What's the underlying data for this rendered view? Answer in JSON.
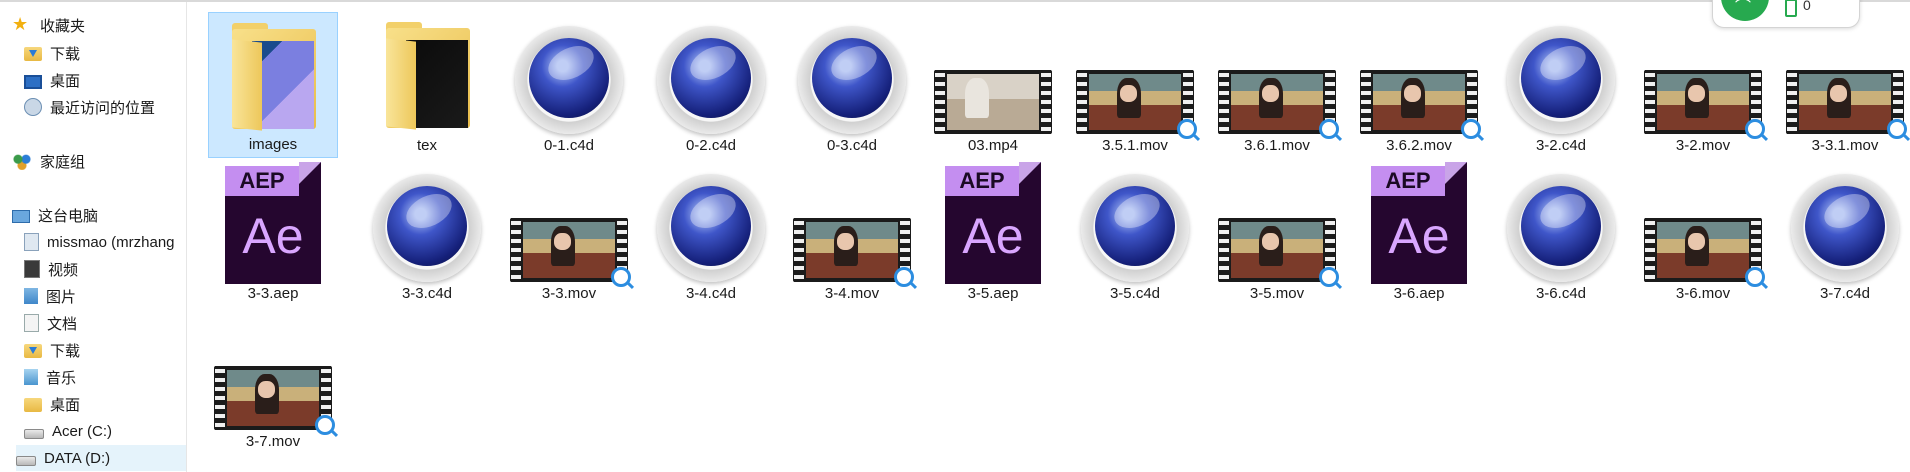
{
  "sidebar": {
    "items": [
      {
        "label": "收藏夹",
        "icon": "star-icon"
      },
      {
        "label": "下载",
        "icon": "downloads-folder-icon"
      },
      {
        "label": "桌面",
        "icon": "desktop-icon"
      },
      {
        "label": "最近访问的位置",
        "icon": "recent-places-icon"
      },
      {
        "label": "家庭组",
        "icon": "homegroup-icon"
      },
      {
        "label": "这台电脑",
        "icon": "this-pc-icon"
      },
      {
        "label": "missmao (mrzhang",
        "icon": "user-icon"
      },
      {
        "label": "视频",
        "icon": "videos-icon"
      },
      {
        "label": "图片",
        "icon": "pictures-icon"
      },
      {
        "label": "文档",
        "icon": "documents-icon"
      },
      {
        "label": "下载",
        "icon": "downloads-folder-icon"
      },
      {
        "label": "音乐",
        "icon": "music-icon"
      },
      {
        "label": "桌面",
        "icon": "desktop-folder-icon"
      },
      {
        "label": "Acer (C:)",
        "icon": "drive-icon"
      },
      {
        "label": "DATA (D:)",
        "icon": "drive-icon"
      }
    ]
  },
  "files": [
    {
      "name": "images",
      "type": "folder",
      "selected": true
    },
    {
      "name": "tex",
      "type": "folder"
    },
    {
      "name": "0-1.c4d",
      "type": "c4d"
    },
    {
      "name": "0-2.c4d",
      "type": "c4d"
    },
    {
      "name": "0-3.c4d",
      "type": "c4d"
    },
    {
      "name": "03.mp4",
      "type": "mp4"
    },
    {
      "name": "3.5.1.mov",
      "type": "mov"
    },
    {
      "name": "3.6.1.mov",
      "type": "mov"
    },
    {
      "name": "3.6.2.mov",
      "type": "mov"
    },
    {
      "name": "3-2.c4d",
      "type": "c4d"
    },
    {
      "name": "3-2.mov",
      "type": "mov"
    },
    {
      "name": "3-3.1.mov",
      "type": "mov"
    },
    {
      "name": "3-3.aep",
      "type": "aep"
    },
    {
      "name": "3-3.c4d",
      "type": "c4d"
    },
    {
      "name": "3-3.mov",
      "type": "mov"
    },
    {
      "name": "3-4.c4d",
      "type": "c4d"
    },
    {
      "name": "3-4.mov",
      "type": "mov"
    },
    {
      "name": "3-5.aep",
      "type": "aep"
    },
    {
      "name": "3-5.c4d",
      "type": "c4d"
    },
    {
      "name": "3-5.mov",
      "type": "mov"
    },
    {
      "name": "3-6.aep",
      "type": "aep"
    },
    {
      "name": "3-6.c4d",
      "type": "c4d"
    },
    {
      "name": "3-6.mov",
      "type": "mov"
    },
    {
      "name": "3-7.c4d",
      "type": "c4d"
    },
    {
      "name": "3-7.mov",
      "type": "mov"
    }
  ],
  "aep": {
    "tag": "AEP",
    "mark": "Ae"
  },
  "widget": {
    "count": "0"
  }
}
